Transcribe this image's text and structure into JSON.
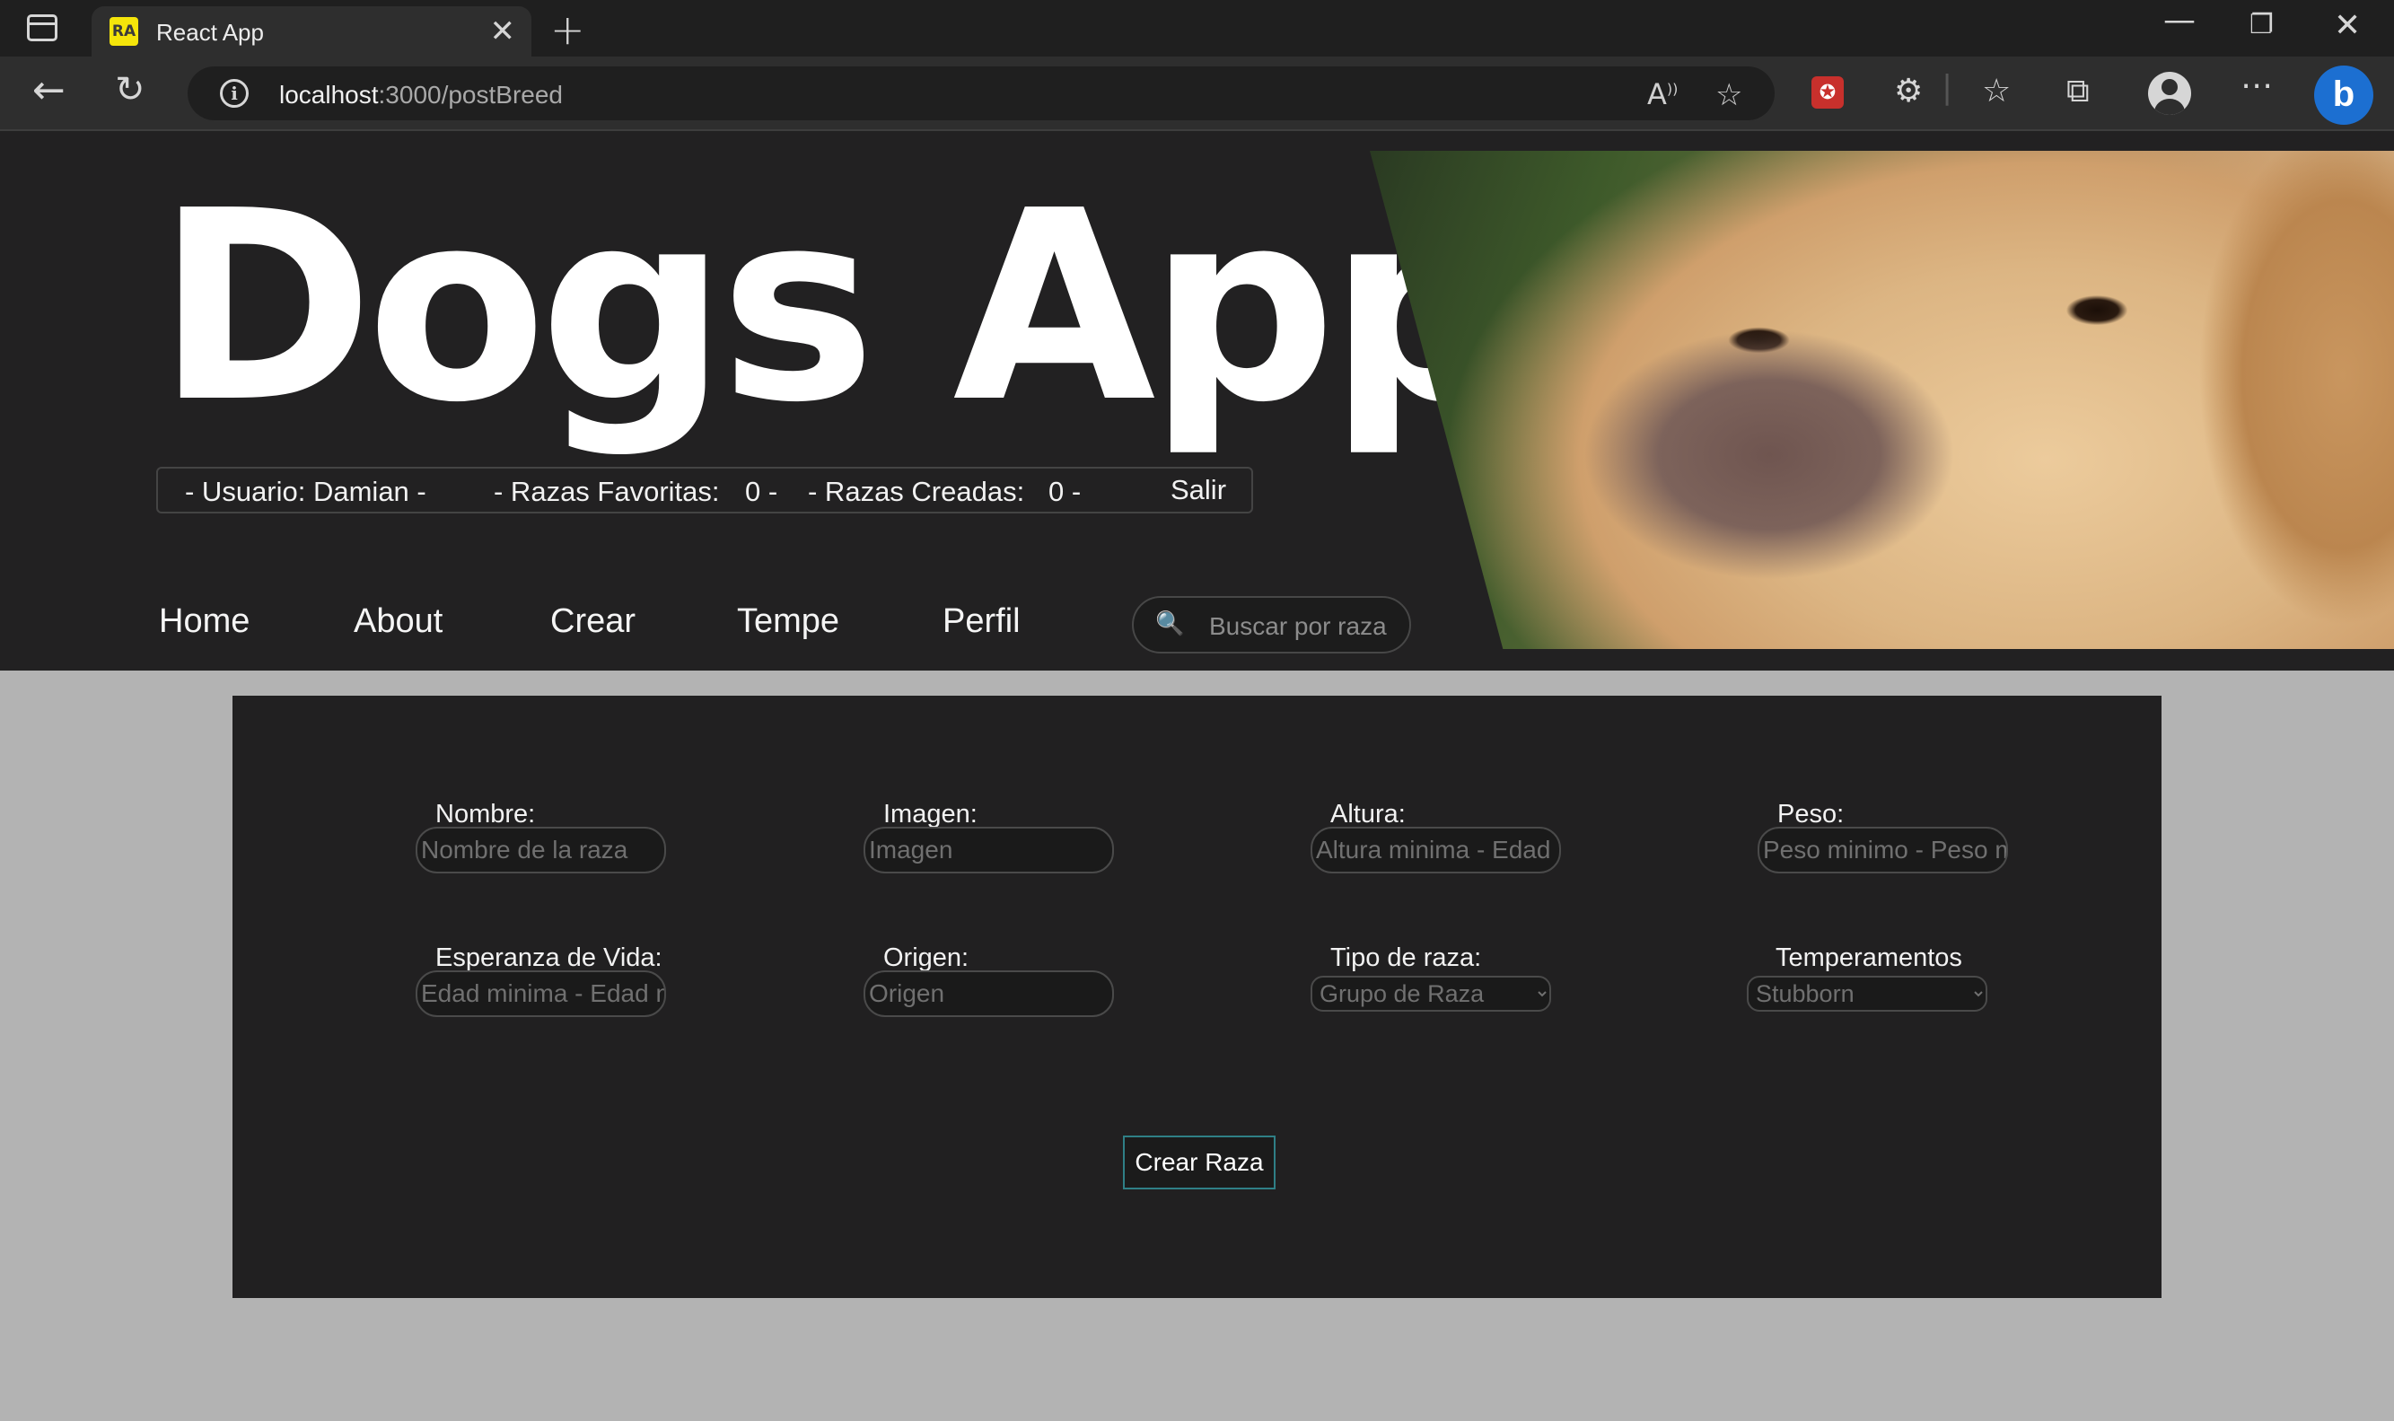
{
  "browser": {
    "tab_title": "React App",
    "favicon_text": "RA",
    "tab_close_glyph": "✕",
    "new_tab_glyph": "+",
    "url_host": "localhost",
    "url_path": ":3000/postBreed",
    "window_controls": {
      "minimize": "—",
      "restore": "❐",
      "close": "✕"
    },
    "icons": [
      "sidebar-icon",
      "back-icon",
      "refresh-icon",
      "info-icon",
      "read-aloud-icon",
      "add-favorite-icon",
      "extension-icon",
      "extensions-icon",
      "favorites-icon",
      "collections-icon",
      "profile-icon",
      "more-icon",
      "bing-icon"
    ]
  },
  "header": {
    "title": "Dogs App",
    "user_bar": {
      "usuario": "- Usuario: Damian -",
      "favoritas_label": "- Razas Favoritas:",
      "favoritas_count": "0 -",
      "creadas_label": "- Razas Creadas:",
      "creadas_count": "0 -",
      "logout": "Salir"
    },
    "nav": [
      "Home",
      "About",
      "Crear",
      "Tempe",
      "Perfil"
    ],
    "search_placeholder": "Buscar por raza"
  },
  "form": {
    "fields": [
      {
        "label": "Nombre:",
        "placeholder": "Nombre de la raza"
      },
      {
        "label": "Imagen:",
        "placeholder": "Imagen"
      },
      {
        "label": "Altura:",
        "placeholder": "Altura minima - Edad maxima"
      },
      {
        "label": "Peso:",
        "placeholder": "Peso minimo - Peso maximo"
      },
      {
        "label": "Esperanza de Vida:",
        "placeholder": "Edad minima - Edad maxima"
      },
      {
        "label": "Origen:",
        "placeholder": "Origen"
      }
    ],
    "tipo_label": "Tipo de raza:",
    "tipo_selected": "Grupo de Raza",
    "temperamentos_label": "Temperamentos",
    "temperamentos_selected": "Stubborn",
    "submit_label": "Crear Raza"
  }
}
